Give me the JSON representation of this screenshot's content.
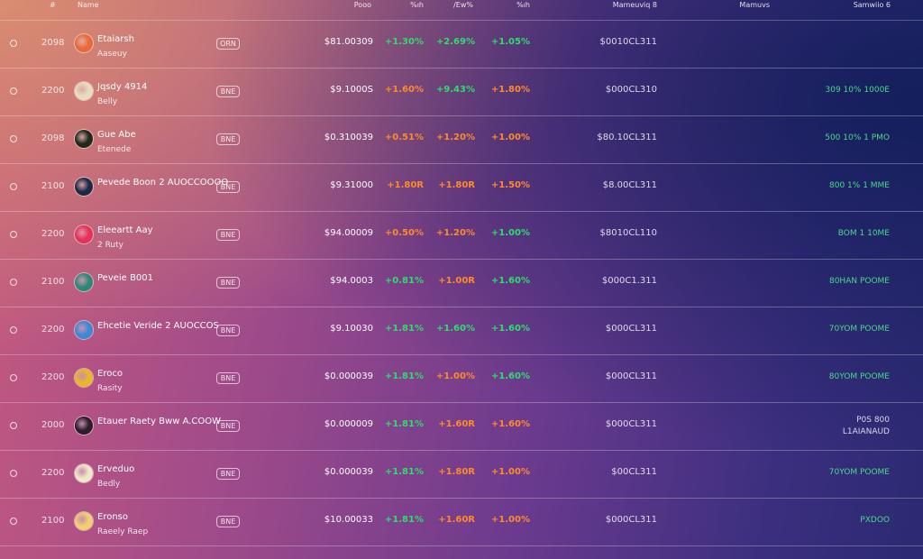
{
  "header": {
    "rank": "#",
    "name": "Name",
    "price": "Pooo",
    "h1": "%ıh",
    "h24": "/Ew%",
    "d7": "%ıh",
    "mcap": "Mameuviq 8",
    "volume": "Mamuvs",
    "supply": "Samwiio 6"
  },
  "rows": [
    {
      "rank": "2098",
      "icon": "gear-coin-icon",
      "icon_color": "#e86a3a",
      "name": "Etaiarsh",
      "sub": "Aaseuy",
      "ticker": "ORN",
      "price": "$81.00309",
      "c1": "+1.30%",
      "c1c": "green",
      "c2": "+2.69%",
      "c2c": "green",
      "c3": "+1.05%",
      "c3c": "green",
      "mcap": "$0010CL311",
      "supply": "",
      "supply2": ""
    },
    {
      "rank": "2200",
      "icon": "skull-coin-icon",
      "icon_color": "#e8dcc0",
      "name": "Jqsdy 4914",
      "sub": "Belly",
      "ticker": "BNE",
      "price": "$9.1000S",
      "c1": "+1.60%",
      "c1c": "orange",
      "c2": "+9.43%",
      "c2c": "green",
      "c3": "+1.80%",
      "c3c": "orange",
      "mcap": "$000CL310",
      "supply": "309 10% 1000E",
      "supply2": ""
    },
    {
      "rank": "2098",
      "icon": "dark-coin-icon",
      "icon_color": "#1e2a1a",
      "name": "Gue Abe",
      "sub": "Etenede",
      "ticker": "BNE",
      "price": "$0.310039",
      "c1": "+0.51%",
      "c1c": "orange",
      "c2": "+1.20%",
      "c2c": "orange",
      "c3": "+1.00%",
      "c3c": "orange",
      "mcap": "$80.10CL311",
      "supply": "500 10% 1 PMO",
      "supply2": ""
    },
    {
      "rank": "2100",
      "icon": "square-coin-icon",
      "icon_color": "#1a2a44",
      "name": "Pevede Boon 2 AUOCCOOOO",
      "sub": "",
      "ticker": "BNE",
      "price": "$9.31000",
      "c1": "+1.80R",
      "c1c": "orange",
      "c2": "+1.80R",
      "c2c": "orange",
      "c3": "+1.50%",
      "c3c": "orange",
      "mcap": "$8.00CL311",
      "supply": "800 1% 1 MME",
      "supply2": ""
    },
    {
      "rank": "2200",
      "icon": "heart-coin-icon",
      "icon_color": "#e8305a",
      "name": "Eleeartt Aay",
      "sub": "2 Ruty",
      "ticker": "BNE",
      "price": "$94.00009",
      "c1": "+0.50%",
      "c1c": "orange",
      "c2": "+1.20%",
      "c2c": "orange",
      "c3": "+1.00%",
      "c3c": "green",
      "mcap": "$8010CL110",
      "supply": "BOM 1 10ME",
      "supply2": ""
    },
    {
      "rank": "2100",
      "icon": "globe-coin-icon",
      "icon_color": "#2a8a7a",
      "name": "Peveie B001",
      "sub": "",
      "ticker": "BNE",
      "price": "$94.0003",
      "c1": "+0.81%",
      "c1c": "green",
      "c2": "+1.00R",
      "c2c": "orange",
      "c3": "+1.60%",
      "c3c": "green",
      "mcap": "$000C1.311",
      "supply": "80HAN POOME",
      "supply2": ""
    },
    {
      "rank": "2200",
      "icon": "blue-coin-icon",
      "icon_color": "#3a8ad8",
      "name": "Ehcetie Veride 2 AUOCCOS",
      "sub": "",
      "ticker": "BNE",
      "price": "$9.10030",
      "c1": "+1.81%",
      "c1c": "green",
      "c2": "+1.60%",
      "c2c": "green",
      "c3": "+1.60%",
      "c3c": "green",
      "mcap": "$000CL311",
      "supply": "70YOM POOME",
      "supply2": ""
    },
    {
      "rank": "2200",
      "icon": "gold-coin-icon",
      "icon_color": "#e8b82a",
      "name": "Eroco",
      "sub": "Rasity",
      "ticker": "BNE",
      "price": "$0.000039",
      "c1": "+1.81%",
      "c1c": "green",
      "c2": "+1.00%",
      "c2c": "orange",
      "c3": "+1.60%",
      "c3c": "green",
      "mcap": "$000CL311",
      "supply": "80YOM POOME",
      "supply2": ""
    },
    {
      "rank": "2000",
      "icon": "dark-coin-icon",
      "icon_color": "#2a1e2a",
      "name": "Etauer Raety Bww A.COOW",
      "sub": "",
      "ticker": "BNE",
      "price": "$0.000009",
      "c1": "+1.81%",
      "c1c": "green",
      "c2": "+1.60R",
      "c2c": "orange",
      "c3": "+1.60%",
      "c3c": "orange",
      "mcap": "$000CL311",
      "supply": "P0S 800",
      "supply2": "L1AIANAUD"
    },
    {
      "rank": "2200",
      "icon": "stripe-coin-icon",
      "icon_color": "#f0e8c8",
      "name": "Erveduo",
      "sub": "Bedly",
      "ticker": "BNE",
      "price": "$0.000039",
      "c1": "+1.81%",
      "c1c": "green",
      "c2": "+1.80R",
      "c2c": "orange",
      "c3": "+1.00%",
      "c3c": "orange",
      "mcap": "$00CL311",
      "supply": "70YOM POOME",
      "supply2": ""
    },
    {
      "rank": "2100",
      "icon": "gold-coin-icon",
      "icon_color": "#f0d070",
      "name": "Eronso",
      "sub": "Raeely Raep",
      "ticker": "BNE",
      "price": "$10.00033",
      "c1": "+1.81%",
      "c1c": "green",
      "c2": "+1.60R",
      "c2c": "orange",
      "c3": "+1.00%",
      "c3c": "orange",
      "mcap": "$000CL311",
      "supply": "PXDOO",
      "supply2": ""
    }
  ]
}
